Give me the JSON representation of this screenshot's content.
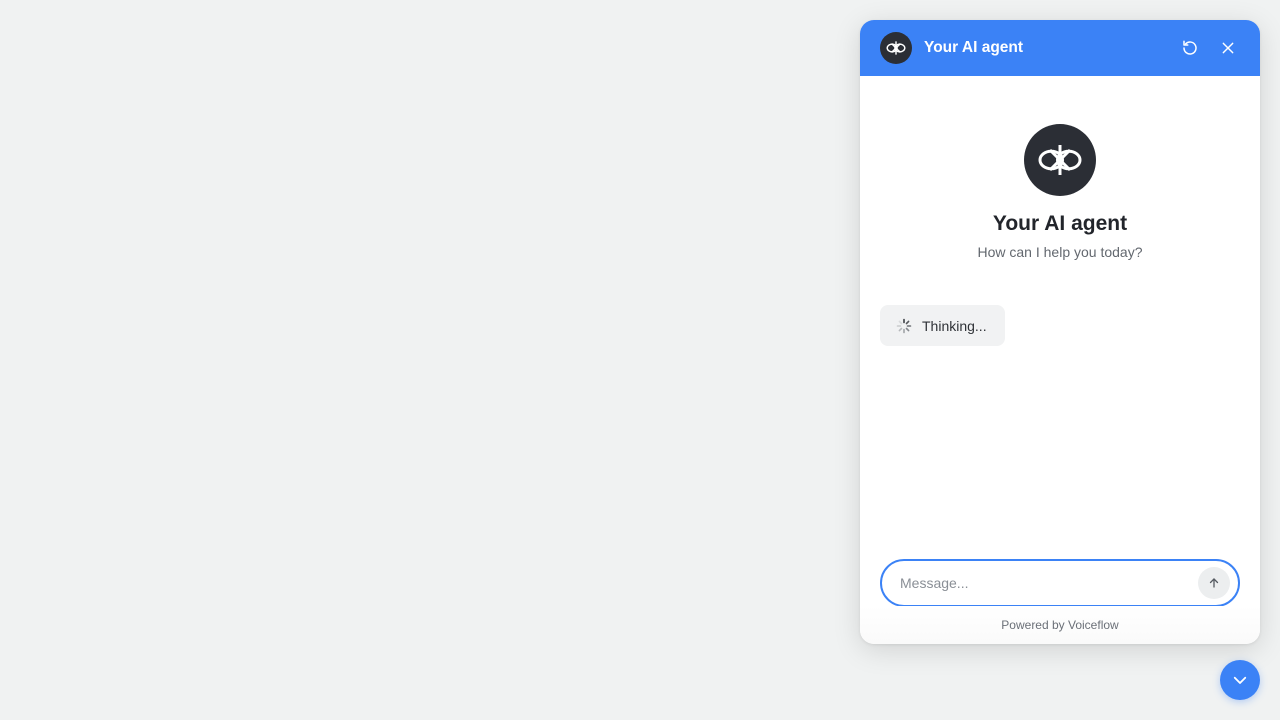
{
  "header": {
    "title": "Your AI agent",
    "icons": {
      "avatar": "voiceflow-logo-icon",
      "restart": "restart-icon",
      "close": "close-icon"
    }
  },
  "intro": {
    "title": "Your AI agent",
    "subtitle": "How can I help you today?"
  },
  "status": {
    "text": "Thinking...",
    "icon": "spinner-icon"
  },
  "composer": {
    "placeholder": "Message...",
    "value": "",
    "send_icon": "arrow-up-icon"
  },
  "footer": {
    "text": "Powered by Voiceflow"
  },
  "launcher": {
    "icon": "chevron-down-icon"
  },
  "colors": {
    "accent": "#3b82f6",
    "avatar_bg": "#2b2e35",
    "page_bg": "#f0f2f2"
  }
}
